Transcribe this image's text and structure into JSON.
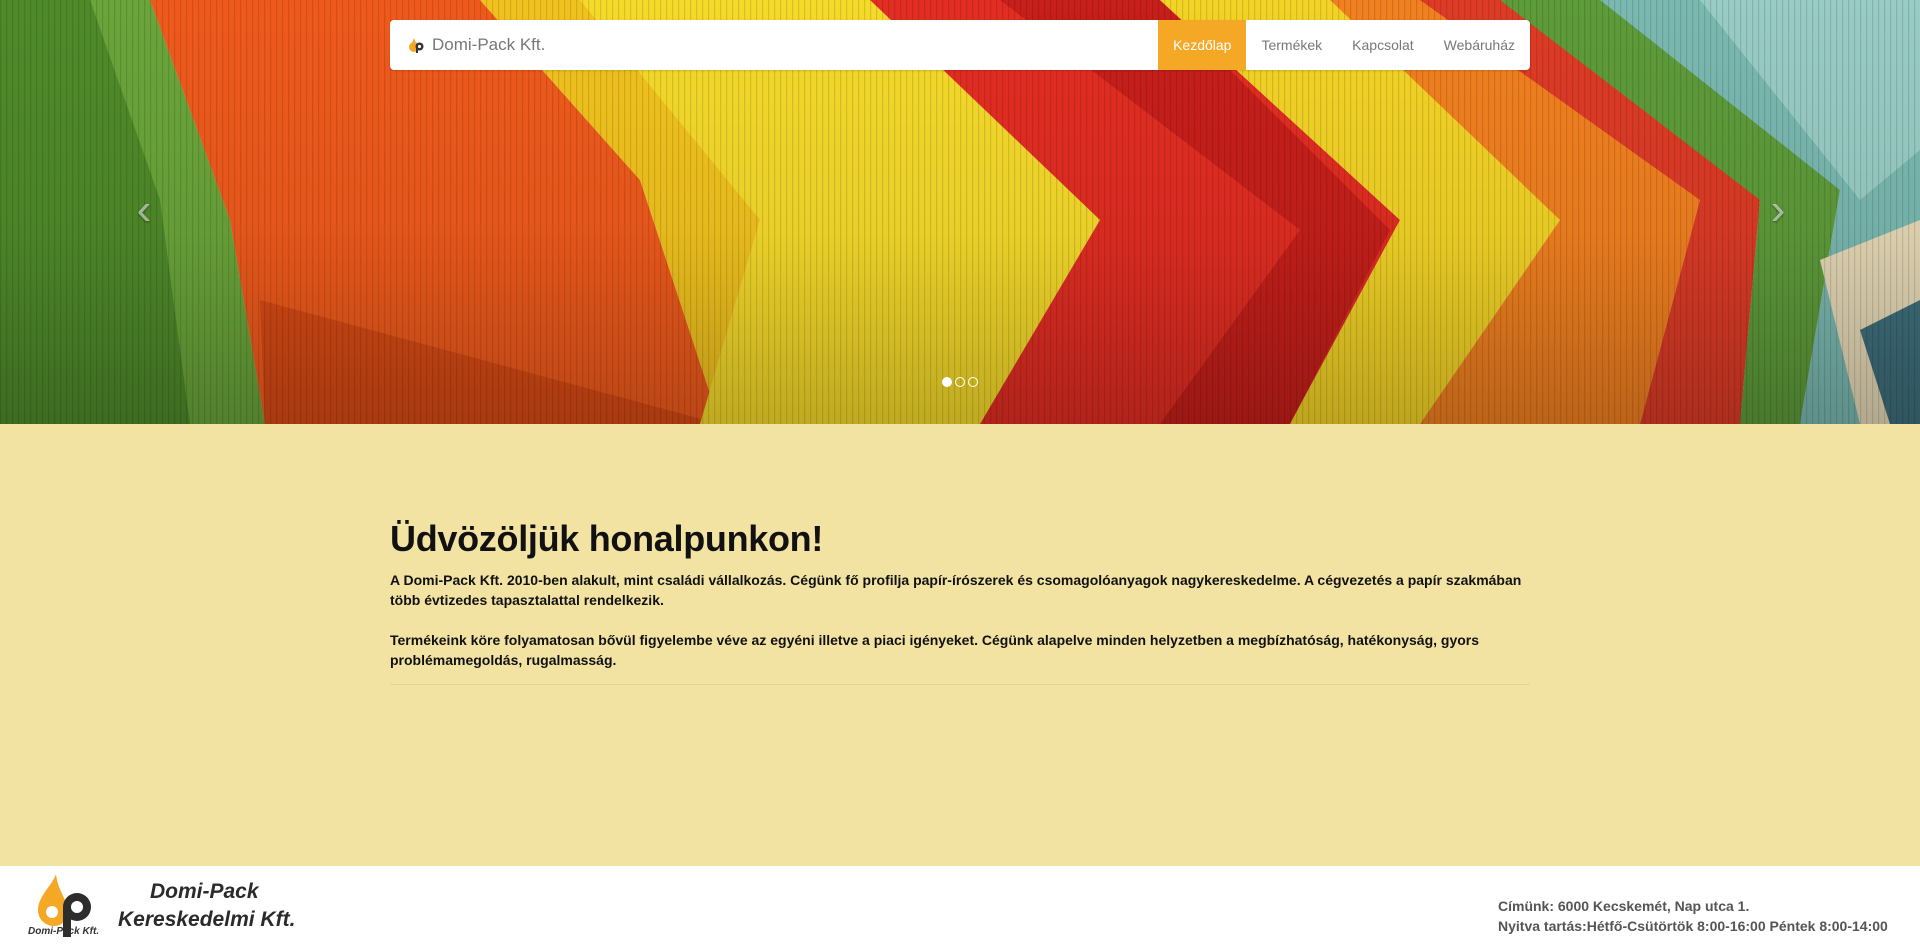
{
  "navbar": {
    "brand_name": "Domi-Pack Kft.",
    "items": [
      {
        "label": "Kezdőlap",
        "active": true
      },
      {
        "label": "Termékek",
        "active": false
      },
      {
        "label": "Kapcsolat",
        "active": false
      },
      {
        "label": "Webáruház",
        "active": false
      }
    ]
  },
  "carousel": {
    "prev_icon": "chevron-left-icon",
    "next_icon": "chevron-right-icon",
    "slide_count": 3,
    "active_slide": 1
  },
  "main": {
    "title": "Üdvözöljük honalpunkon!",
    "paragraph_1": "A Domi-Pack Kft. 2010-ben alakult, mint családi vállalkozás. Cégünk fő profilja papír-írószerek és csomagolóanyagok nagykereskedelme. A cégvezetés a papír szakmában több évtizedes tapasztalattal rendelkezik.",
    "paragraph_2": "Termékeink köre folyamatosan bővül figyelembe véve az egyéni illetve a piaci igényeket. Cégünk alapelve minden helyzetben a megbízhatóság, hatékonyság, gyors problémamegoldás, rugalmasság."
  },
  "footer": {
    "logo_caption": "Domi-Pack Kft.",
    "company_line_1": "Domi-Pack",
    "company_line_2": "Kereskedelmi Kft.",
    "address": "Címünk: 6000 Kecskemét, Nap utca 1.",
    "hours": "Nyitva tartás:Hétfő-Csütörtök 8:00-16:00 Péntek 8:00-14:00"
  },
  "colors": {
    "accent": "#f4a826",
    "main_background": "#f3e3a3",
    "navbar_background": "#ffffff"
  }
}
